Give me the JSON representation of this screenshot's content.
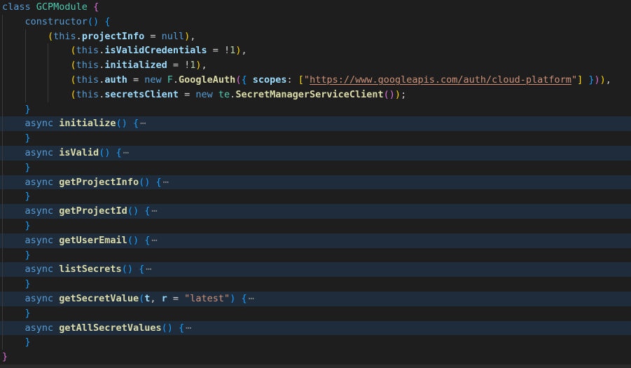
{
  "editor": {
    "background": "#1e1e1e",
    "fold_highlight_color": "#1e2c3c",
    "indent_guide_color": "#3a3a3a",
    "bottom_partial_line_color": "#2a2a2b",
    "char_w": 8.128,
    "left_pad": 3,
    "palette": {
      "kw": "#569cd6",
      "cls": "#4ec9b0",
      "fn": "#dcdcaa",
      "pr": "#9cdcfe",
      "pl": "#d4d4d4",
      "num": "#b5cea8",
      "str": "#ce9178",
      "url": "#ce9178",
      "b1": "#ffd700",
      "b2": "#da70d6",
      "b3": "#179fff",
      "el": "#8a8a8a"
    },
    "fold_ellipsis_char": "⋯",
    "lines": [
      {
        "ind": 0,
        "hl": false,
        "tok": [
          [
            "class ",
            "kw"
          ],
          [
            "GCPModule",
            "cls"
          ],
          [
            " ",
            "pl"
          ],
          [
            "{",
            "b2"
          ]
        ]
      },
      {
        "ind": 4,
        "hl": false,
        "tok": [
          [
            "constructor",
            "kw"
          ],
          [
            "(",
            "b3"
          ],
          [
            ")",
            "b3"
          ],
          [
            " ",
            "pl"
          ],
          [
            "{",
            "b3"
          ]
        ]
      },
      {
        "ind": 8,
        "hl": false,
        "tok": [
          [
            "(",
            "b1"
          ],
          [
            "this",
            "kw"
          ],
          [
            ".",
            "pl"
          ],
          [
            "projectInfo",
            "pr"
          ],
          [
            " = ",
            "pl"
          ],
          [
            "null",
            "kw"
          ],
          [
            ")",
            "b1"
          ],
          [
            ",",
            "pl"
          ]
        ]
      },
      {
        "ind": 12,
        "hl": false,
        "tok": [
          [
            "(",
            "b1"
          ],
          [
            "this",
            "kw"
          ],
          [
            ".",
            "pl"
          ],
          [
            "isValidCredentials",
            "pr"
          ],
          [
            " = ",
            "pl"
          ],
          [
            "!",
            "pl"
          ],
          [
            "1",
            "num"
          ],
          [
            ")",
            "b1"
          ],
          [
            ",",
            "pl"
          ]
        ]
      },
      {
        "ind": 12,
        "hl": false,
        "tok": [
          [
            "(",
            "b1"
          ],
          [
            "this",
            "kw"
          ],
          [
            ".",
            "pl"
          ],
          [
            "initialized",
            "pr"
          ],
          [
            " = ",
            "pl"
          ],
          [
            "!",
            "pl"
          ],
          [
            "1",
            "num"
          ],
          [
            ")",
            "b1"
          ],
          [
            ",",
            "pl"
          ]
        ]
      },
      {
        "ind": 12,
        "hl": false,
        "tok": [
          [
            "(",
            "b1"
          ],
          [
            "this",
            "kw"
          ],
          [
            ".",
            "pl"
          ],
          [
            "auth",
            "pr"
          ],
          [
            " = ",
            "pl"
          ],
          [
            "new ",
            "kw"
          ],
          [
            "F",
            "cls"
          ],
          [
            ".",
            "pl"
          ],
          [
            "GoogleAuth",
            "fn"
          ],
          [
            "(",
            "b2"
          ],
          [
            "{",
            "b3"
          ],
          [
            " ",
            "pl"
          ],
          [
            "scopes",
            "pr"
          ],
          [
            ": ",
            "pl"
          ],
          [
            "[",
            "b1"
          ],
          [
            "\"",
            "str"
          ],
          [
            "https://www.googleapis.com/auth/cloud-platform",
            "url"
          ],
          [
            "\"",
            "str"
          ],
          [
            "]",
            "b1"
          ],
          [
            " ",
            "pl"
          ],
          [
            "}",
            "b3"
          ],
          [
            ")",
            "b2"
          ],
          [
            ")",
            "b1"
          ],
          [
            ",",
            "pl"
          ]
        ]
      },
      {
        "ind": 12,
        "hl": false,
        "tok": [
          [
            "(",
            "b1"
          ],
          [
            "this",
            "kw"
          ],
          [
            ".",
            "pl"
          ],
          [
            "secretsClient",
            "pr"
          ],
          [
            " = ",
            "pl"
          ],
          [
            "new ",
            "kw"
          ],
          [
            "te",
            "cls"
          ],
          [
            ".",
            "pl"
          ],
          [
            "SecretManagerServiceClient",
            "fn"
          ],
          [
            "(",
            "b2"
          ],
          [
            ")",
            "b2"
          ],
          [
            ")",
            "b1"
          ],
          [
            ";",
            "pl"
          ]
        ]
      },
      {
        "ind": 4,
        "hl": false,
        "tok": [
          [
            "}",
            "b3"
          ]
        ]
      },
      {
        "ind": 4,
        "hl": true,
        "tok": [
          [
            "async ",
            "kw"
          ],
          [
            "initialize",
            "fn"
          ],
          [
            "(",
            "b3"
          ],
          [
            ")",
            "b3"
          ],
          [
            " ",
            "pl"
          ],
          [
            "{",
            "b3"
          ],
          [
            "⋯",
            "el"
          ]
        ]
      },
      {
        "ind": 4,
        "hl": false,
        "tok": [
          [
            "}",
            "b3"
          ]
        ]
      },
      {
        "ind": 4,
        "hl": true,
        "tok": [
          [
            "async ",
            "kw"
          ],
          [
            "isValid",
            "fn"
          ],
          [
            "(",
            "b3"
          ],
          [
            ")",
            "b3"
          ],
          [
            " ",
            "pl"
          ],
          [
            "{",
            "b3"
          ],
          [
            "⋯",
            "el"
          ]
        ]
      },
      {
        "ind": 4,
        "hl": false,
        "tok": [
          [
            "}",
            "b3"
          ]
        ]
      },
      {
        "ind": 4,
        "hl": true,
        "tok": [
          [
            "async ",
            "kw"
          ],
          [
            "getProjectInfo",
            "fn"
          ],
          [
            "(",
            "b3"
          ],
          [
            ")",
            "b3"
          ],
          [
            " ",
            "pl"
          ],
          [
            "{",
            "b3"
          ],
          [
            "⋯",
            "el"
          ]
        ]
      },
      {
        "ind": 4,
        "hl": false,
        "tok": [
          [
            "}",
            "b3"
          ]
        ]
      },
      {
        "ind": 4,
        "hl": true,
        "tok": [
          [
            "async ",
            "kw"
          ],
          [
            "getProjectId",
            "fn"
          ],
          [
            "(",
            "b3"
          ],
          [
            ")",
            "b3"
          ],
          [
            " ",
            "pl"
          ],
          [
            "{",
            "b3"
          ],
          [
            "⋯",
            "el"
          ]
        ]
      },
      {
        "ind": 4,
        "hl": false,
        "tok": [
          [
            "}",
            "b3"
          ]
        ]
      },
      {
        "ind": 4,
        "hl": true,
        "tok": [
          [
            "async ",
            "kw"
          ],
          [
            "getUserEmail",
            "fn"
          ],
          [
            "(",
            "b3"
          ],
          [
            ")",
            "b3"
          ],
          [
            " ",
            "pl"
          ],
          [
            "{",
            "b3"
          ],
          [
            "⋯",
            "el"
          ]
        ]
      },
      {
        "ind": 4,
        "hl": false,
        "tok": [
          [
            "}",
            "b3"
          ]
        ]
      },
      {
        "ind": 4,
        "hl": true,
        "tok": [
          [
            "async ",
            "kw"
          ],
          [
            "listSecrets",
            "fn"
          ],
          [
            "(",
            "b3"
          ],
          [
            ")",
            "b3"
          ],
          [
            " ",
            "pl"
          ],
          [
            "{",
            "b3"
          ],
          [
            "⋯",
            "el"
          ]
        ]
      },
      {
        "ind": 4,
        "hl": false,
        "tok": [
          [
            "}",
            "b3"
          ]
        ]
      },
      {
        "ind": 4,
        "hl": true,
        "tok": [
          [
            "async ",
            "kw"
          ],
          [
            "getSecretValue",
            "fn"
          ],
          [
            "(",
            "b3"
          ],
          [
            "t",
            "pr"
          ],
          [
            ", ",
            "pl"
          ],
          [
            "r",
            "pr"
          ],
          [
            " = ",
            "pl"
          ],
          [
            "\"latest\"",
            "str"
          ],
          [
            ")",
            "b3"
          ],
          [
            " ",
            "pl"
          ],
          [
            "{",
            "b3"
          ],
          [
            "⋯",
            "el"
          ]
        ]
      },
      {
        "ind": 4,
        "hl": false,
        "tok": [
          [
            "}",
            "b3"
          ]
        ]
      },
      {
        "ind": 4,
        "hl": true,
        "tok": [
          [
            "async ",
            "kw"
          ],
          [
            "getAllSecretValues",
            "fn"
          ],
          [
            "(",
            "b3"
          ],
          [
            ")",
            "b3"
          ],
          [
            " ",
            "pl"
          ],
          [
            "{",
            "b3"
          ],
          [
            "⋯",
            "el"
          ]
        ]
      },
      {
        "ind": 4,
        "hl": false,
        "tok": [
          [
            "}",
            "b3"
          ]
        ]
      },
      {
        "ind": 0,
        "hl": false,
        "tok": [
          [
            "}",
            "b2"
          ]
        ]
      }
    ]
  }
}
